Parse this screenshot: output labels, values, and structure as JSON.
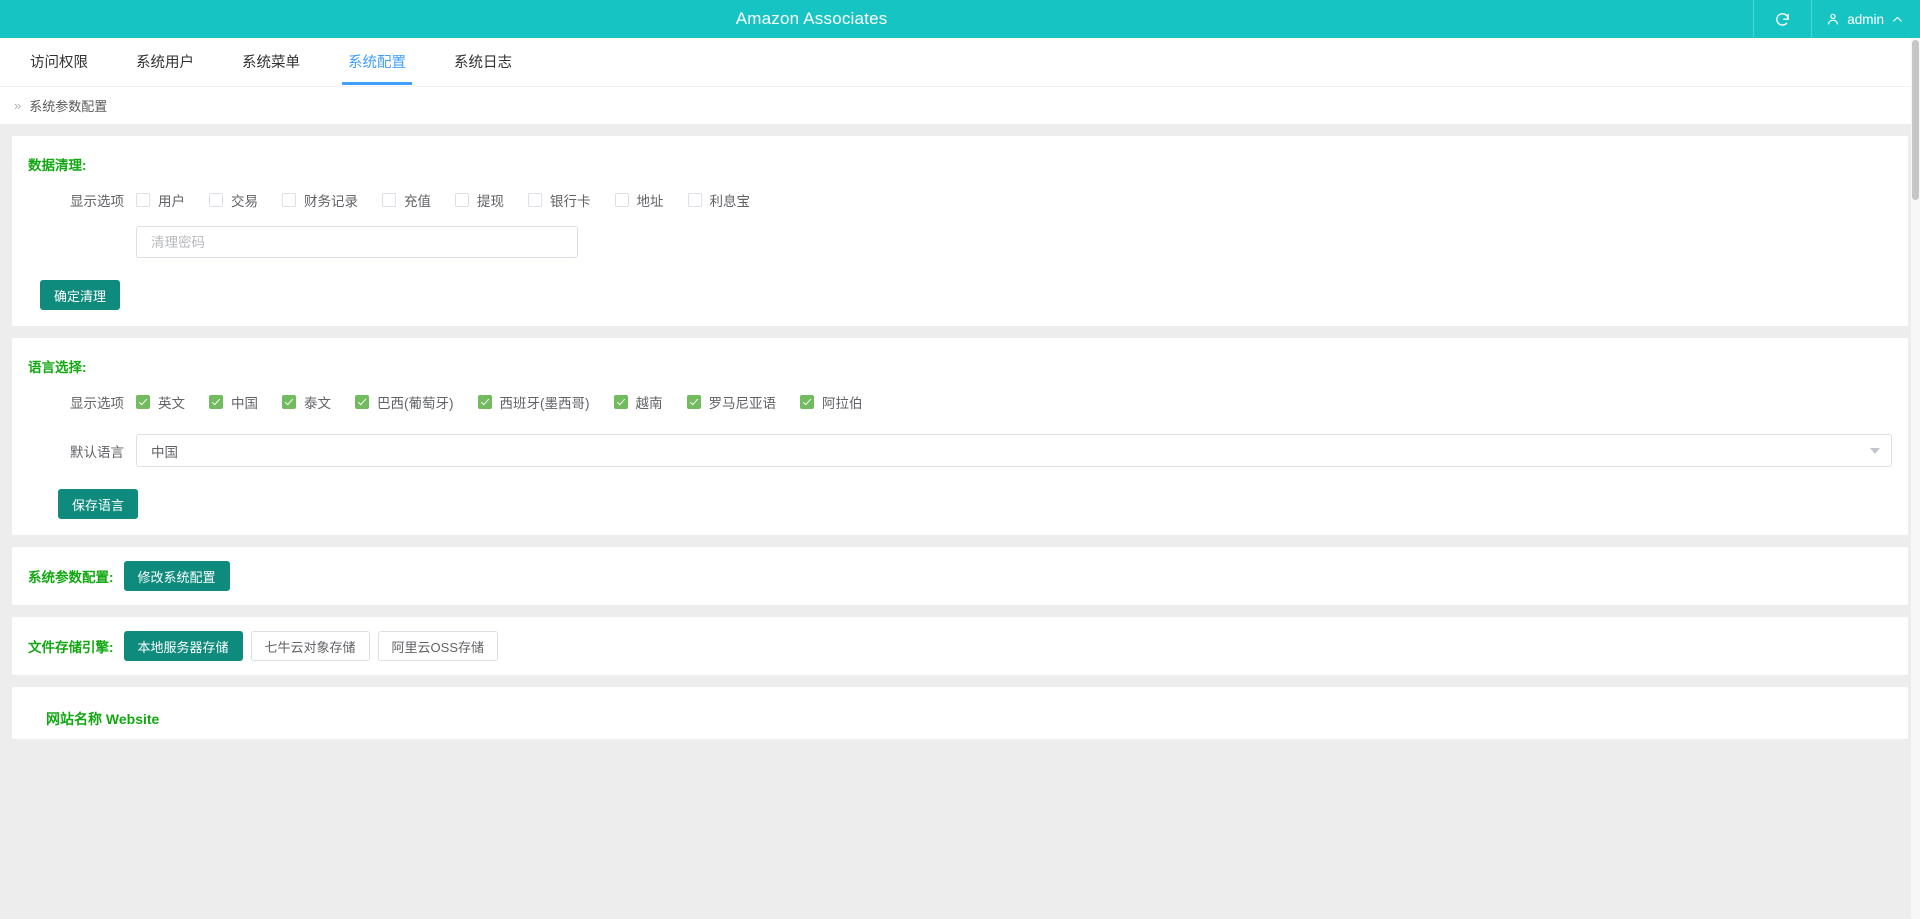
{
  "header": {
    "title": "Amazon Associates",
    "refresh_icon": "refresh-icon",
    "user_icon": "user-icon",
    "username": "admin",
    "chevron_icon": "chevron-up-icon",
    "brand_color": "#17c4c4"
  },
  "tabs": [
    {
      "label": "访问权限",
      "active": false
    },
    {
      "label": "系统用户",
      "active": false
    },
    {
      "label": "系统菜单",
      "active": false
    },
    {
      "label": "系统配置",
      "active": true
    },
    {
      "label": "系统日志",
      "active": false
    }
  ],
  "breadcrumb": {
    "arrow": "»",
    "text": "系统参数配置"
  },
  "data_clean": {
    "title": "数据清理:",
    "options_label": "显示选项",
    "options": [
      {
        "label": "用户",
        "checked": false
      },
      {
        "label": "交易",
        "checked": false
      },
      {
        "label": "财务记录",
        "checked": false
      },
      {
        "label": "充值",
        "checked": false
      },
      {
        "label": "提现",
        "checked": false
      },
      {
        "label": "银行卡",
        "checked": false
      },
      {
        "label": "地址",
        "checked": false
      },
      {
        "label": "利息宝",
        "checked": false
      }
    ],
    "password_placeholder": "清理密码",
    "password_value": "",
    "submit_label": "确定清理"
  },
  "language": {
    "title": "语言选择:",
    "options_label": "显示选项",
    "options": [
      {
        "label": "英文",
        "checked": true
      },
      {
        "label": "中国",
        "checked": true
      },
      {
        "label": "泰文",
        "checked": true
      },
      {
        "label": "巴西(葡萄牙)",
        "checked": true
      },
      {
        "label": "西班牙(墨西哥)",
        "checked": true
      },
      {
        "label": "越南",
        "checked": true
      },
      {
        "label": "罗马尼亚语",
        "checked": true
      },
      {
        "label": "阿拉伯",
        "checked": true
      }
    ],
    "default_label": "默认语言",
    "default_value": "中国",
    "save_label": "保存语言"
  },
  "sys_params": {
    "title": "系统参数配置:",
    "button_label": "修改系统配置"
  },
  "storage": {
    "title": "文件存储引擎:",
    "options": [
      {
        "label": "本地服务器存储",
        "active": true
      },
      {
        "label": "七牛云对象存储",
        "active": false
      },
      {
        "label": "阿里云OSS存储",
        "active": false
      }
    ]
  },
  "bottom": {
    "title": "网站名称 Website"
  },
  "colors": {
    "teal": "#0e8b7d",
    "green_label": "#13a813",
    "active_tab": "#409eff",
    "checkbox_green": "#73bb5f"
  }
}
